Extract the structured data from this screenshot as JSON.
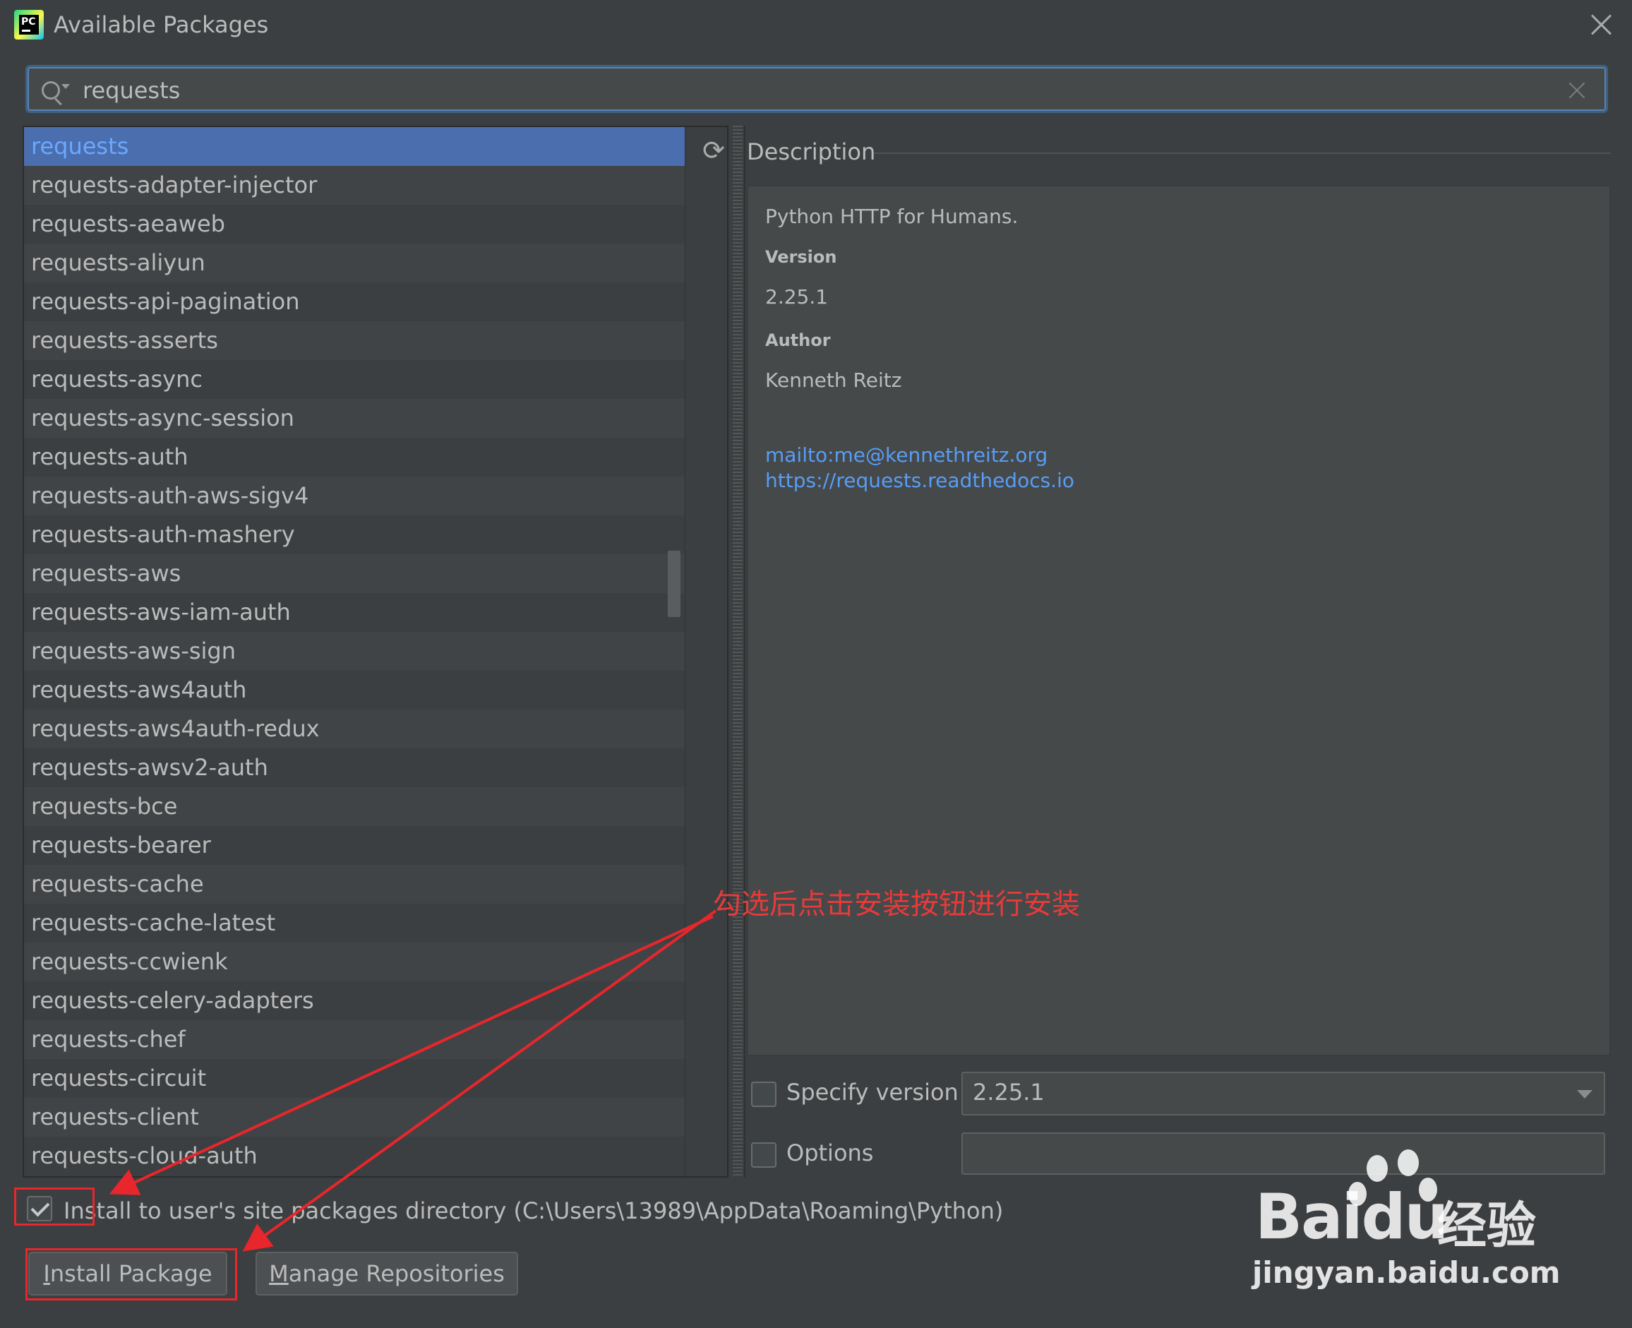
{
  "window": {
    "title": "Available Packages"
  },
  "search": {
    "value": "requests"
  },
  "packages": [
    "requests",
    "requests-adapter-injector",
    "requests-aeaweb",
    "requests-aliyun",
    "requests-api-pagination",
    "requests-asserts",
    "requests-async",
    "requests-async-session",
    "requests-auth",
    "requests-auth-aws-sigv4",
    "requests-auth-mashery",
    "requests-aws",
    "requests-aws-iam-auth",
    "requests-aws-sign",
    "requests-aws4auth",
    "requests-aws4auth-redux",
    "requests-awsv2-auth",
    "requests-bce",
    "requests-bearer",
    "requests-cache",
    "requests-cache-latest",
    "requests-ccwienk",
    "requests-celery-adapters",
    "requests-chef",
    "requests-circuit",
    "requests-client",
    "requests-cloud-auth"
  ],
  "selected_index": 0,
  "description": {
    "header": "Description",
    "summary": "Python HTTP for Humans.",
    "version_label": "Version",
    "version": "2.25.1",
    "author_label": "Author",
    "author": "Kenneth Reitz",
    "email_link": "mailto:me@kennethreitz.org",
    "home_link": "https://requests.readthedocs.io"
  },
  "options": {
    "specify_version_label": "Specify version",
    "specify_version_checked": false,
    "version_value": "2.25.1",
    "options_label": "Options",
    "options_checked": false,
    "options_value": "",
    "install_user_label": "Install to user's site packages directory (C:\\Users\\13989\\AppData\\Roaming\\Python)",
    "install_user_checked": true
  },
  "buttons": {
    "install_mnemonic": "I",
    "install_rest": "nstall Package",
    "manage_mnemonic": "M",
    "manage_rest": "anage Repositories"
  },
  "annotation": "勾选后点击安装按钮进行安装",
  "watermark": {
    "brand": "Baidu",
    "cn": "经验",
    "url": "jingyan.baidu.com"
  },
  "colors": {
    "accent_red": "#e8262b",
    "selection": "#4b6eaf",
    "link": "#589df6"
  },
  "icons": [
    "pycharm-app-icon",
    "close-icon",
    "search-icon",
    "clear-icon",
    "refresh-icon",
    "chevron-down-icon",
    "checkbox-icon"
  ]
}
